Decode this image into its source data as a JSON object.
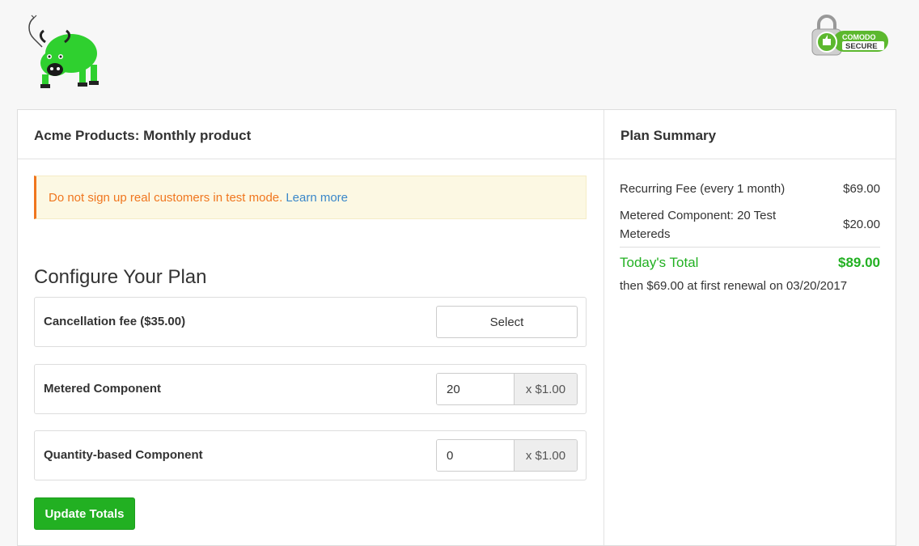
{
  "header": {
    "logo_icon": "green-bull-logo",
    "badge": {
      "icon": "comodo-secure-badge",
      "top": "COMODO",
      "bottom": "SECURE"
    }
  },
  "product_panel": {
    "title": "Acme Products: Monthly product",
    "alert": {
      "message": "Do not sign up real customers in test mode.",
      "link": "Learn more"
    },
    "section_title": "Configure Your Plan",
    "components": [
      {
        "label": "Cancellation fee ($35.00)",
        "action": "Select"
      },
      {
        "label": "Metered Component",
        "value": "20",
        "unit_price": "x $1.00"
      },
      {
        "label": "Quantity-based Component",
        "value": "0",
        "unit_price": "x $1.00"
      }
    ],
    "update_button": "Update Totals"
  },
  "summary_panel": {
    "title": "Plan Summary",
    "lines": [
      {
        "label": "Recurring Fee (every 1 month)",
        "amount": "$69.00"
      },
      {
        "label_line1": "Metered Component: 20 Test",
        "label_line2": "Metereds",
        "amount": "$20.00"
      }
    ],
    "total_label": "Today's Total",
    "total_amount": "$89.00",
    "renewal_note": "then $69.00 at first renewal on 03/20/2017"
  },
  "colors": {
    "accent_green": "#22b022",
    "warning_orange": "#f0761e",
    "link_blue": "#3a87c9"
  }
}
